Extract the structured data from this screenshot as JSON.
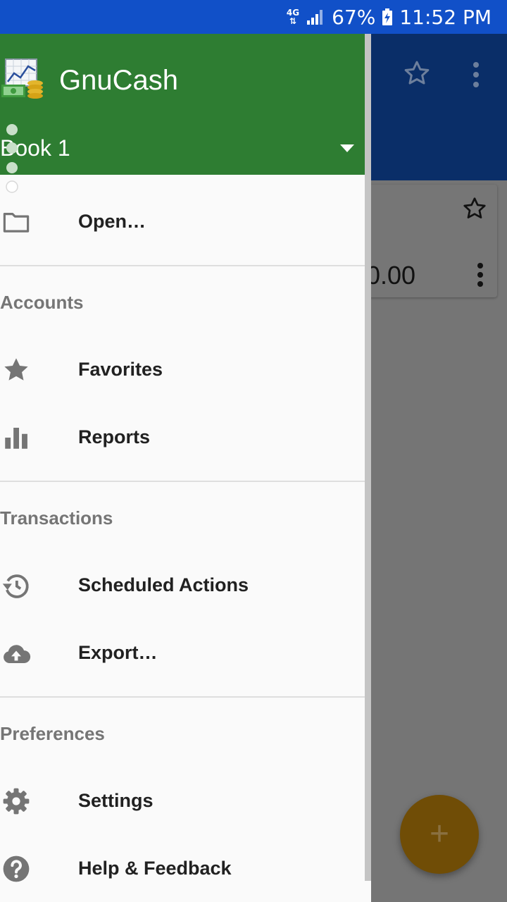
{
  "status_bar": {
    "network": "4G",
    "battery": "67%",
    "time": "11:52 PM"
  },
  "background": {
    "card_amount": "0.00"
  },
  "drawer": {
    "app_name": "GnuCash",
    "book_name": "Book 1",
    "open_item": "Open…",
    "sections": [
      {
        "title": "Accounts",
        "items": [
          {
            "label": "Favorites",
            "icon": "star-icon"
          },
          {
            "label": "Reports",
            "icon": "bar-chart-icon"
          }
        ]
      },
      {
        "title": "Transactions",
        "items": [
          {
            "label": "Scheduled Actions",
            "icon": "history-icon"
          },
          {
            "label": "Export…",
            "icon": "cloud-upload-icon"
          }
        ]
      },
      {
        "title": "Preferences",
        "items": [
          {
            "label": "Settings",
            "icon": "gear-icon"
          },
          {
            "label": "Help & Feedback",
            "icon": "help-icon"
          }
        ]
      }
    ]
  },
  "colors": {
    "status_bar": "#1150c8",
    "drawer_header": "#2e7d32",
    "fab": "#704d06",
    "icon": "#757575"
  }
}
